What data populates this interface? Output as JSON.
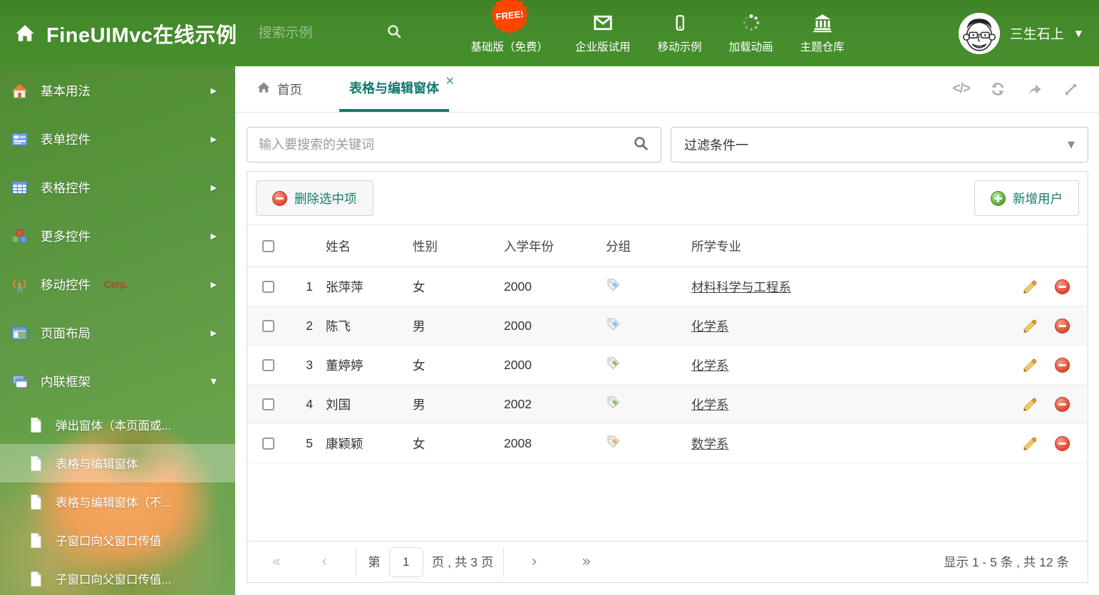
{
  "colors": {
    "header_green": "#448a2b",
    "accent_teal": "#0f7b6a",
    "badge_orange": "#ff4502",
    "corp_red": "#e11f1f",
    "tag_blue": "#8cc6f0",
    "tag_green": "#94c167",
    "tag_orange": "#f7b066"
  },
  "header": {
    "title": "FineUIMvc在线示例",
    "search_placeholder": "搜索示例",
    "free_badge": "FREE!",
    "menu": [
      {
        "label": "基础版（免费）",
        "icon": "download-icon"
      },
      {
        "label": "企业版试用",
        "icon": "envelope-icon"
      },
      {
        "label": "移动示例",
        "icon": "mobile-icon"
      },
      {
        "label": "加载动画",
        "icon": "spinner-icon"
      },
      {
        "label": "主题仓库",
        "icon": "bank-icon"
      }
    ],
    "user_name": "三生石上"
  },
  "sidebar": {
    "items": [
      {
        "label": "基本用法",
        "icon": "home-icon"
      },
      {
        "label": "表单控件",
        "icon": "form-icon"
      },
      {
        "label": "表格控件",
        "icon": "table-icon"
      },
      {
        "label": "更多控件",
        "icon": "cubes-icon"
      },
      {
        "label": "移动控件",
        "badge": "Corp.",
        "icon": "antenna-icon"
      },
      {
        "label": "页面布局",
        "icon": "layout-icon"
      },
      {
        "label": "内联框架",
        "icon": "frames-icon",
        "expanded": true
      }
    ],
    "subitems": [
      {
        "label": "弹出窗体（本页面或..."
      },
      {
        "label": "表格与编辑窗体",
        "selected": true
      },
      {
        "label": "表格与编辑窗体（不..."
      },
      {
        "label": "子窗口向父窗口传值"
      },
      {
        "label": "子窗口向父窗口传值..."
      }
    ]
  },
  "tabs": {
    "home_label": "首页",
    "active_label": "表格与编辑窗体"
  },
  "filter": {
    "search_placeholder": "输入要搜索的关键词",
    "dropdown_value": "过滤条件一"
  },
  "toolbar": {
    "delete_label": "删除选中项",
    "add_label": "新增用户"
  },
  "table": {
    "headers": {
      "name": "姓名",
      "gender": "性别",
      "year": "入学年份",
      "group": "分组",
      "major": "所学专业"
    },
    "rows": [
      {
        "index": "1",
        "name": "张萍萍",
        "gender": "女",
        "year": "2000",
        "tag_color": "#8cc6f0",
        "major": "材料科学与工程系"
      },
      {
        "index": "2",
        "name": "陈飞",
        "gender": "男",
        "year": "2000",
        "tag_color": "#8cc6f0",
        "major": "化学系"
      },
      {
        "index": "3",
        "name": "董婷婷",
        "gender": "女",
        "year": "2000",
        "tag_color": "#94c167",
        "major": "化学系"
      },
      {
        "index": "4",
        "name": "刘国",
        "gender": "男",
        "year": "2002",
        "tag_color": "#94c167",
        "major": "化学系"
      },
      {
        "index": "5",
        "name": "康颖颖",
        "gender": "女",
        "year": "2008",
        "tag_color": "#f7b066",
        "major": "数学系"
      }
    ]
  },
  "pagination": {
    "page_prefix": "第",
    "page_value": "1",
    "page_suffix": "页 , 共 3 页",
    "summary": "显示 1 - 5 条 , 共 12 条"
  }
}
